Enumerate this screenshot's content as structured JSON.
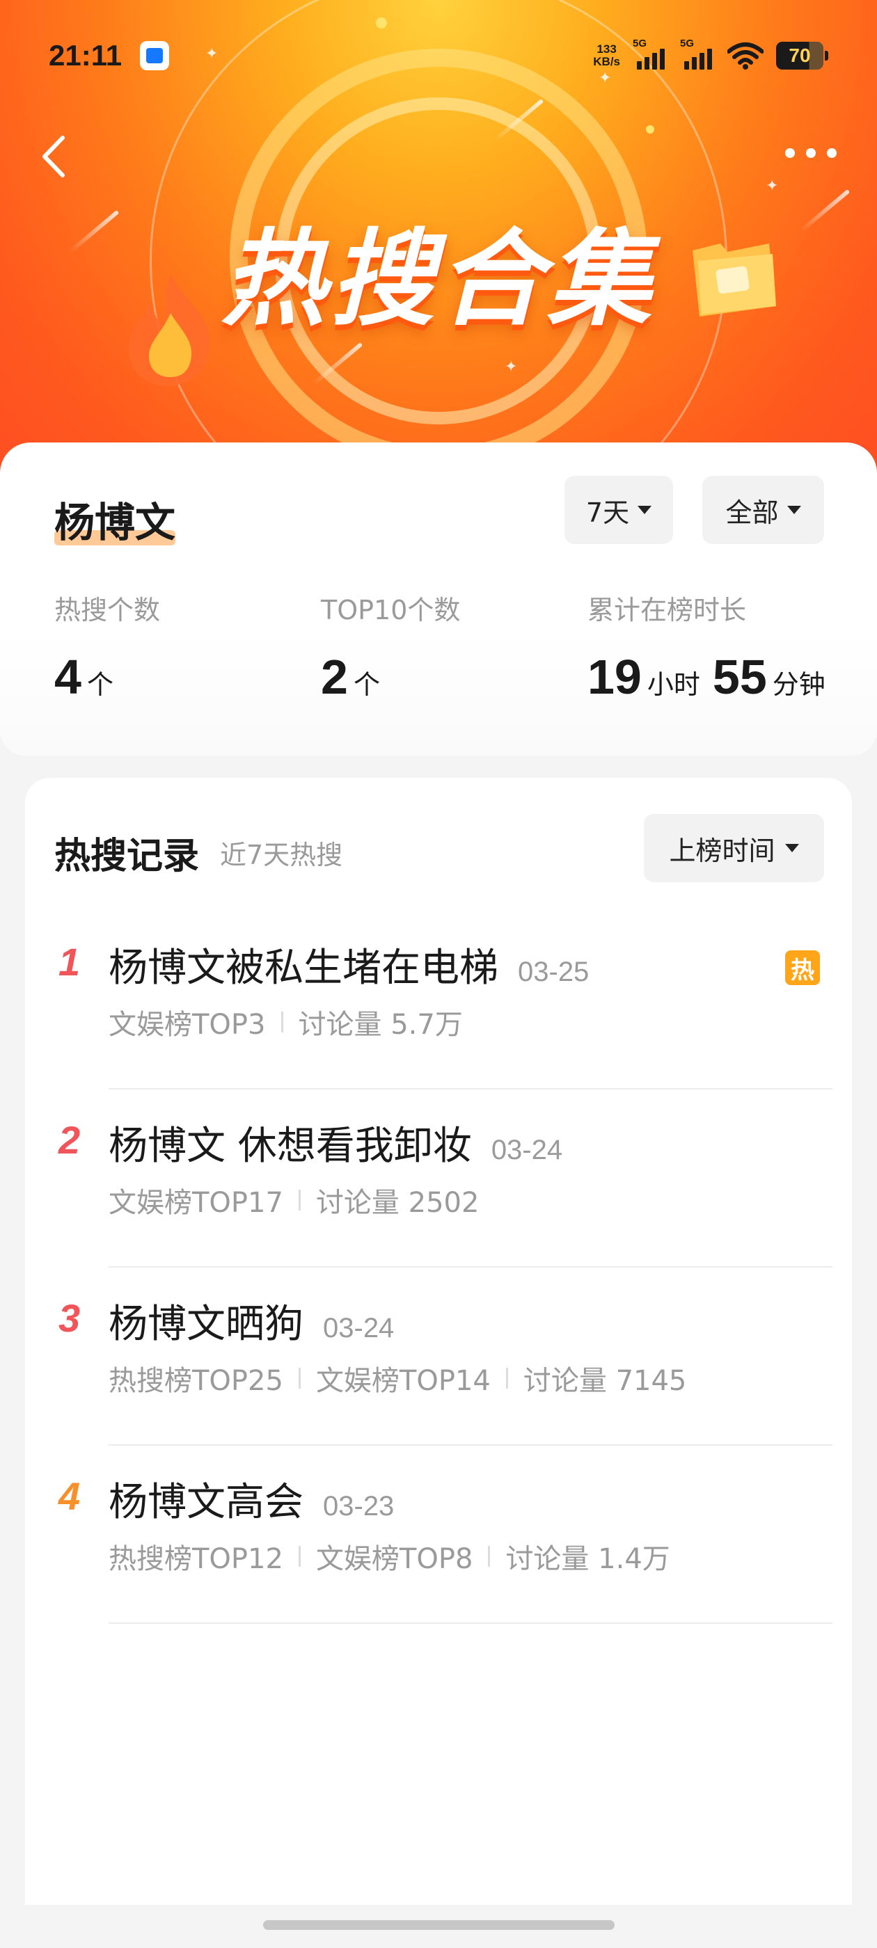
{
  "status_bar": {
    "time": "21:11",
    "net_speed_value": "133",
    "net_speed_unit": "KB/s",
    "sim1": "5G",
    "sim2": "5G",
    "battery": "70"
  },
  "header": {
    "banner_title": "热搜合集"
  },
  "summary": {
    "name": "杨博文",
    "range_filter": "7天",
    "type_filter": "全部",
    "stats": [
      {
        "label": "热搜个数",
        "value": "4",
        "unit": "个"
      },
      {
        "label": "TOP10个数",
        "value": "2",
        "unit": "个"
      },
      {
        "label": "累计在榜时长",
        "hours": "19",
        "hours_unit": "小时",
        "minutes": "55",
        "minutes_unit": "分钟"
      }
    ]
  },
  "records": {
    "title": "热搜记录",
    "subtitle": "近7天热搜",
    "sort_label": "上榜时间",
    "items": [
      {
        "rank": "1",
        "rank_color": "#f0555a",
        "title": "杨博文被私生堵在电梯",
        "date": "03-25",
        "meta": [
          "文娱榜TOP3",
          "讨论量 5.7万"
        ],
        "badge": "热"
      },
      {
        "rank": "2",
        "rank_color": "#f0555a",
        "title": "杨博文 休想看我卸妆",
        "date": "03-24",
        "meta": [
          "文娱榜TOP17",
          "讨论量 2502"
        ]
      },
      {
        "rank": "3",
        "rank_color": "#f0555a",
        "title": "杨博文晒狗",
        "date": "03-24",
        "meta": [
          "热搜榜TOP25",
          "文娱榜TOP14",
          "讨论量 7145"
        ]
      },
      {
        "rank": "4",
        "rank_color": "#f7902b",
        "title": "杨博文高会",
        "date": "03-23",
        "meta": [
          "热搜榜TOP12",
          "文娱榜TOP8",
          "讨论量 1.4万"
        ]
      }
    ]
  }
}
